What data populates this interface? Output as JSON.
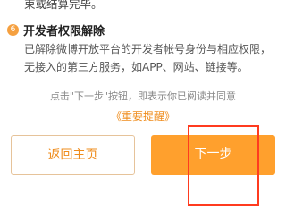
{
  "top_fragment": "束或结算完毕。",
  "section": {
    "number": "6",
    "title": "开发者权限解除",
    "body": "已解除微博开放平台的开发者帐号身份与相应权限，无接入的第三方服务，如APP、网站、链接等。"
  },
  "notice_text": "点击\"下一步\"按钮，即表示你已阅读并同意",
  "link_text": "《重要提醒》",
  "buttons": {
    "home": "返回主页",
    "next": "下一步"
  },
  "colors": {
    "accent": "#ef8c1c",
    "next_button_bg": "#ffa02d",
    "highlight_box": "#ff3b1f"
  }
}
